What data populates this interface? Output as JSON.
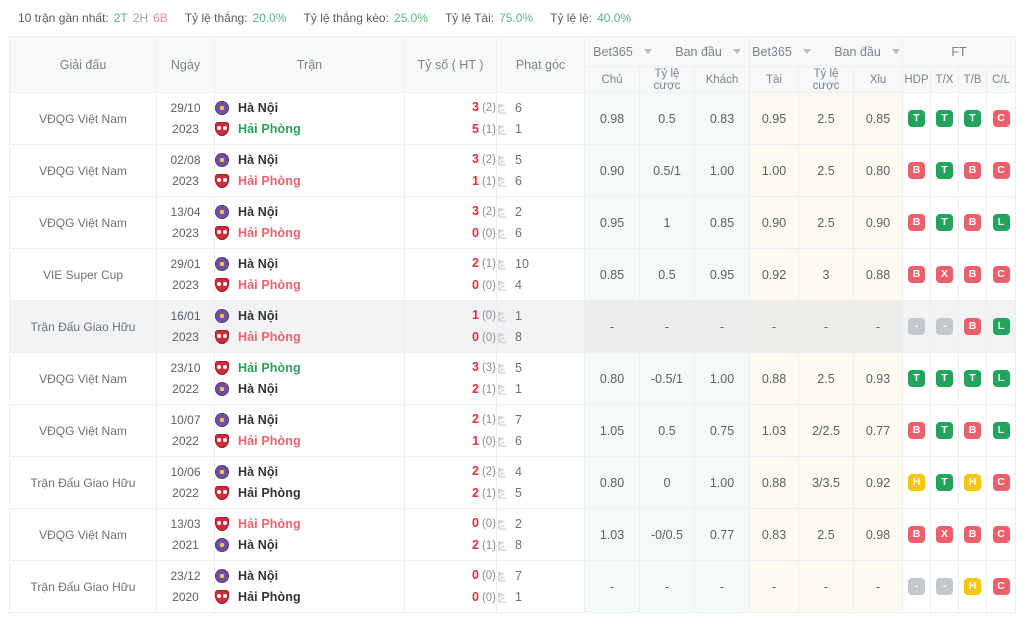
{
  "summary": {
    "recent_label": "10 trận gần nhất:",
    "streak": [
      {
        "text": "2T",
        "tone": "green"
      },
      {
        "text": "2H",
        "tone": "gray"
      },
      {
        "text": "6B",
        "tone": "pink"
      }
    ],
    "stats": [
      {
        "label": "Tỷ lệ thắng:",
        "value": "20.0%",
        "tone": "green"
      },
      {
        "label": "Tỷ lệ thắng kèo:",
        "value": "25.0%",
        "tone": "green"
      },
      {
        "label": "Tỷ lệ Tài:",
        "value": "75.0%",
        "tone": "green"
      },
      {
        "label": "Tỷ lệ lệ:",
        "value": "40.0%",
        "tone": "green"
      }
    ]
  },
  "table": {
    "headers_main": {
      "league": "Giải đấu",
      "date": "Ngày",
      "match": "Trận",
      "score": "Tỷ số ( HT )",
      "corner": "Phạt góc",
      "ft": "FT"
    },
    "handicap_selects": [
      {
        "label": "Bet365",
        "icon": "chevron-down-icon"
      },
      {
        "label": "Ban đầu",
        "icon": "chevron-down-icon"
      }
    ],
    "overunder_selects": [
      {
        "label": "Bet365",
        "icon": "chevron-down-icon"
      },
      {
        "label": "Ban đầu",
        "icon": "chevron-down-icon"
      }
    ],
    "headers_sub": {
      "home": "Chủ",
      "hdp_odds": "Tỷ lệ cược",
      "away": "Khách",
      "over": "Tài",
      "ou_odds": "Tỷ lệ cược",
      "under": "Xỉu",
      "hdp": "HDP",
      "tx": "T/X",
      "tb": "T/B",
      "cl": "C/L"
    },
    "rows": [
      {
        "league": "VĐQG Việt Nam",
        "date_day": "29/10",
        "date_year": "2023",
        "home": {
          "name": "Hà Nội",
          "logo": "hn",
          "tone": "dark"
        },
        "away": {
          "name": "Hải Phòng",
          "logo": "hp",
          "tone": "win"
        },
        "score_home": "3",
        "ht_home": "(2)",
        "score_away": "5",
        "ht_away": "(1)",
        "corner_home": "6",
        "corner_away": "1",
        "hdp": {
          "home": "0.98",
          "line": "0.5",
          "away": "0.83"
        },
        "ou": {
          "over": "0.95",
          "line": "2.5",
          "under": "0.85"
        },
        "ft": [
          {
            "text": "T",
            "tone": "g"
          },
          {
            "text": "T",
            "tone": "g"
          },
          {
            "text": "T",
            "tone": "g"
          },
          {
            "text": "C",
            "tone": "r"
          }
        ],
        "alt": false
      },
      {
        "league": "VĐQG Việt Nam",
        "date_day": "02/08",
        "date_year": "2023",
        "home": {
          "name": "Hà Nội",
          "logo": "hn",
          "tone": "dark"
        },
        "away": {
          "name": "Hải Phòng",
          "logo": "hp",
          "tone": "lose"
        },
        "score_home": "3",
        "ht_home": "(2)",
        "score_away": "1",
        "ht_away": "(1)",
        "corner_home": "5",
        "corner_away": "6",
        "hdp": {
          "home": "0.90",
          "line": "0.5/1",
          "away": "1.00"
        },
        "ou": {
          "over": "1.00",
          "line": "2.5",
          "under": "0.80"
        },
        "ft": [
          {
            "text": "B",
            "tone": "r"
          },
          {
            "text": "T",
            "tone": "g"
          },
          {
            "text": "B",
            "tone": "r"
          },
          {
            "text": "C",
            "tone": "r"
          }
        ],
        "alt": false
      },
      {
        "league": "VĐQG Việt Nam",
        "date_day": "13/04",
        "date_year": "2023",
        "home": {
          "name": "Hà Nội",
          "logo": "hn",
          "tone": "dark"
        },
        "away": {
          "name": "Hải Phòng",
          "logo": "hp",
          "tone": "lose"
        },
        "score_home": "3",
        "ht_home": "(2)",
        "score_away": "0",
        "ht_away": "(0)",
        "corner_home": "2",
        "corner_away": "6",
        "hdp": {
          "home": "0.95",
          "line": "1",
          "away": "0.85"
        },
        "ou": {
          "over": "0.90",
          "line": "2.5",
          "under": "0.90"
        },
        "ft": [
          {
            "text": "B",
            "tone": "r"
          },
          {
            "text": "T",
            "tone": "g"
          },
          {
            "text": "B",
            "tone": "r"
          },
          {
            "text": "L",
            "tone": "g"
          }
        ],
        "alt": false
      },
      {
        "league": "VIE Super Cup",
        "date_day": "29/01",
        "date_year": "2023",
        "home": {
          "name": "Hà Nội",
          "logo": "hn",
          "tone": "dark"
        },
        "away": {
          "name": "Hải Phòng",
          "logo": "hp",
          "tone": "lose"
        },
        "score_home": "2",
        "ht_home": "(1)",
        "score_away": "0",
        "ht_away": "(0)",
        "corner_home": "10",
        "corner_away": "4",
        "hdp": {
          "home": "0.85",
          "line": "0.5",
          "away": "0.95"
        },
        "ou": {
          "over": "0.92",
          "line": "3",
          "under": "0.88"
        },
        "ft": [
          {
            "text": "B",
            "tone": "r"
          },
          {
            "text": "X",
            "tone": "r"
          },
          {
            "text": "B",
            "tone": "r"
          },
          {
            "text": "C",
            "tone": "r"
          }
        ],
        "alt": false
      },
      {
        "league": "Trận Đấu Giao Hữu",
        "date_day": "16/01",
        "date_year": "2023",
        "home": {
          "name": "Hà Nội",
          "logo": "hn",
          "tone": "dark"
        },
        "away": {
          "name": "Hải Phòng",
          "logo": "hp",
          "tone": "lose"
        },
        "score_home": "1",
        "ht_home": "(0)",
        "score_away": "0",
        "ht_away": "(0)",
        "corner_home": "1",
        "corner_away": "8",
        "hdp": {
          "home": "-",
          "line": "-",
          "away": "-"
        },
        "ou": {
          "over": "-",
          "line": "-",
          "under": "-"
        },
        "ft": [
          {
            "text": "-",
            "tone": "n"
          },
          {
            "text": "-",
            "tone": "n"
          },
          {
            "text": "B",
            "tone": "r"
          },
          {
            "text": "L",
            "tone": "g"
          }
        ],
        "alt": true
      },
      {
        "league": "VĐQG Việt Nam",
        "date_day": "23/10",
        "date_year": "2022",
        "home": {
          "name": "Hải Phòng",
          "logo": "hp",
          "tone": "win"
        },
        "away": {
          "name": "Hà Nội",
          "logo": "hn",
          "tone": "dark"
        },
        "score_home": "3",
        "ht_home": "(3)",
        "score_away": "2",
        "ht_away": "(1)",
        "corner_home": "5",
        "corner_away": "1",
        "hdp": {
          "home": "0.80",
          "line": "-0.5/1",
          "away": "1.00"
        },
        "ou": {
          "over": "0.88",
          "line": "2.5",
          "under": "0.93"
        },
        "ft": [
          {
            "text": "T",
            "tone": "g"
          },
          {
            "text": "T",
            "tone": "g"
          },
          {
            "text": "T",
            "tone": "g"
          },
          {
            "text": "L",
            "tone": "g"
          }
        ],
        "alt": false
      },
      {
        "league": "VĐQG Việt Nam",
        "date_day": "10/07",
        "date_year": "2022",
        "home": {
          "name": "Hà Nội",
          "logo": "hn",
          "tone": "dark"
        },
        "away": {
          "name": "Hải Phòng",
          "logo": "hp",
          "tone": "lose"
        },
        "score_home": "2",
        "ht_home": "(1)",
        "score_away": "1",
        "ht_away": "(0)",
        "corner_home": "7",
        "corner_away": "6",
        "hdp": {
          "home": "1.05",
          "line": "0.5",
          "away": "0.75"
        },
        "ou": {
          "over": "1.03",
          "line": "2/2.5",
          "under": "0.77"
        },
        "ft": [
          {
            "text": "B",
            "tone": "r"
          },
          {
            "text": "T",
            "tone": "g"
          },
          {
            "text": "B",
            "tone": "r"
          },
          {
            "text": "L",
            "tone": "g"
          }
        ],
        "alt": false
      },
      {
        "league": "Trận Đấu Giao Hữu",
        "date_day": "10/06",
        "date_year": "2022",
        "home": {
          "name": "Hà Nội",
          "logo": "hn",
          "tone": "dark"
        },
        "away": {
          "name": "Hải Phòng",
          "logo": "hp",
          "tone": "dark"
        },
        "score_home": "2",
        "ht_home": "(2)",
        "score_away": "2",
        "ht_away": "(1)",
        "corner_home": "4",
        "corner_away": "5",
        "hdp": {
          "home": "0.80",
          "line": "0",
          "away": "1.00"
        },
        "ou": {
          "over": "0.88",
          "line": "3/3.5",
          "under": "0.92"
        },
        "ft": [
          {
            "text": "H",
            "tone": "y"
          },
          {
            "text": "T",
            "tone": "g"
          },
          {
            "text": "H",
            "tone": "y"
          },
          {
            "text": "C",
            "tone": "r"
          }
        ],
        "alt": false
      },
      {
        "league": "VĐQG Việt Nam",
        "date_day": "13/03",
        "date_year": "2021",
        "home": {
          "name": "Hải Phòng",
          "logo": "hp",
          "tone": "lose"
        },
        "away": {
          "name": "Hà Nội",
          "logo": "hn",
          "tone": "dark"
        },
        "score_home": "0",
        "ht_home": "(0)",
        "score_away": "2",
        "ht_away": "(1)",
        "corner_home": "2",
        "corner_away": "8",
        "hdp": {
          "home": "1.03",
          "line": "-0/0.5",
          "away": "0.77"
        },
        "ou": {
          "over": "0.83",
          "line": "2.5",
          "under": "0.98"
        },
        "ft": [
          {
            "text": "B",
            "tone": "r"
          },
          {
            "text": "X",
            "tone": "r"
          },
          {
            "text": "B",
            "tone": "r"
          },
          {
            "text": "C",
            "tone": "r"
          }
        ],
        "alt": false
      },
      {
        "league": "Trận Đấu Giao Hữu",
        "date_day": "23/12",
        "date_year": "2020",
        "home": {
          "name": "Hà Nội",
          "logo": "hn",
          "tone": "dark"
        },
        "away": {
          "name": "Hải Phòng",
          "logo": "hp",
          "tone": "dark"
        },
        "score_home": "0",
        "ht_home": "(0)",
        "score_away": "0",
        "ht_away": "(0)",
        "corner_home": "7",
        "corner_away": "1",
        "hdp": {
          "home": "-",
          "line": "-",
          "away": "-"
        },
        "ou": {
          "over": "-",
          "line": "-",
          "under": "-"
        },
        "ft": [
          {
            "text": "-",
            "tone": "n"
          },
          {
            "text": "-",
            "tone": "n"
          },
          {
            "text": "H",
            "tone": "y"
          },
          {
            "text": "C",
            "tone": "r"
          }
        ],
        "alt": false
      }
    ]
  }
}
